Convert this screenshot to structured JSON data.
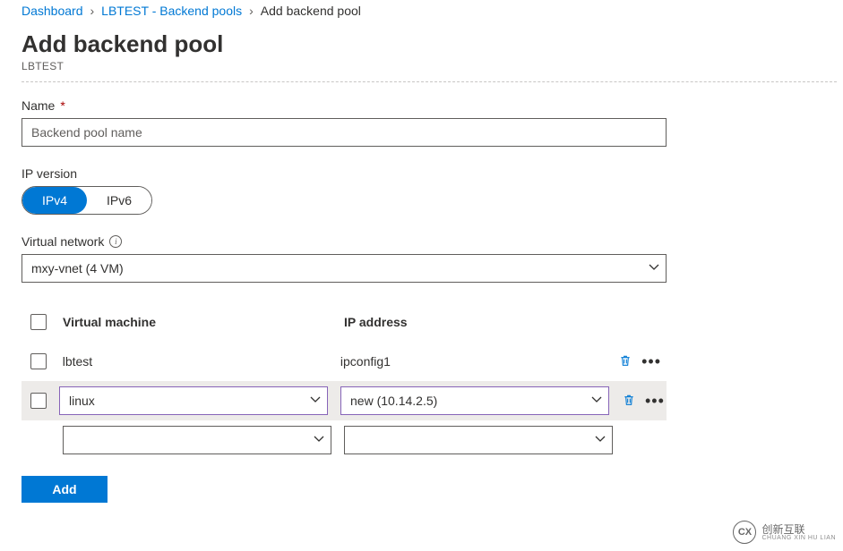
{
  "breadcrumb": {
    "items": [
      {
        "label": "Dashboard",
        "link": true
      },
      {
        "label": "LBTEST - Backend pools",
        "link": true
      },
      {
        "label": "Add backend pool",
        "link": false
      }
    ]
  },
  "header": {
    "title": "Add backend pool",
    "subtitle": "LBTEST"
  },
  "form": {
    "name_label": "Name",
    "name_placeholder": "Backend pool name",
    "ipversion_label": "IP version",
    "ipversion_options": {
      "ipv4": "IPv4",
      "ipv6": "IPv6"
    },
    "vnet_label": "Virtual network",
    "vnet_value": "mxy-vnet (4 VM)"
  },
  "table": {
    "header_vm": "Virtual machine",
    "header_ip": "IP address",
    "rows": [
      {
        "vm": "lbtest",
        "ip": "ipconfig1",
        "select_mode": false,
        "checked": false,
        "highlighted": false
      },
      {
        "vm": "linux",
        "ip": "new (10.14.2.5)",
        "select_mode": true,
        "checked": false,
        "highlighted": true
      },
      {
        "vm": "",
        "ip": "",
        "select_mode": true,
        "checked": null,
        "highlighted": false
      }
    ]
  },
  "actions": {
    "add_label": "Add"
  },
  "watermark": {
    "main": "创新互联",
    "sub": "CHUANG XIN HU LIAN"
  }
}
